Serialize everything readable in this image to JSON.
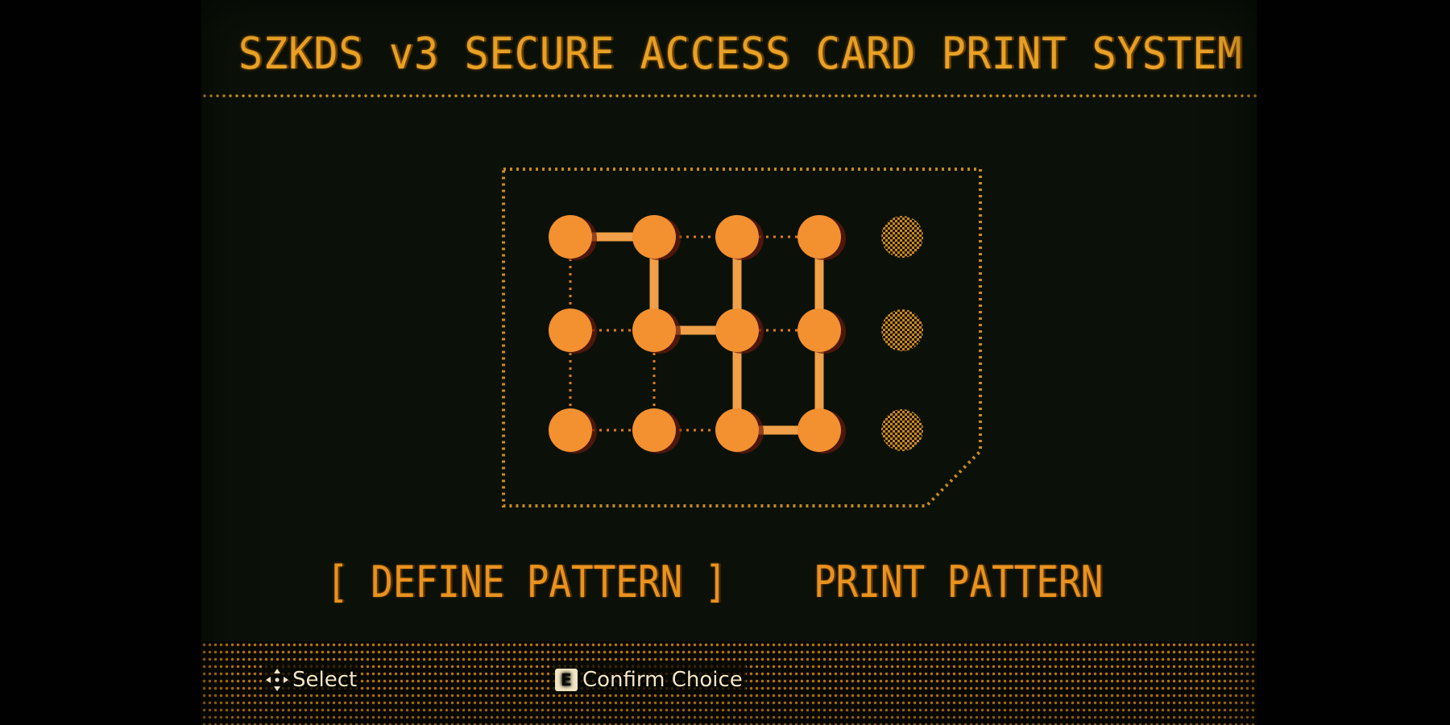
{
  "header": {
    "title": "SZKDS v3 SECURE ACCESS CARD PRINT SYSTEM"
  },
  "pattern": {
    "rows": 3,
    "cols": 4,
    "spare_column_count": 3,
    "path_segments": [
      [
        "r0c0",
        "r0c1"
      ],
      [
        "r0c1",
        "r1c1"
      ],
      [
        "r1c1",
        "r1c2"
      ],
      [
        "r0c2",
        "r1c2"
      ],
      [
        "r1c2",
        "r2c2"
      ],
      [
        "r2c2",
        "r2c3"
      ],
      [
        "r2c3",
        "r1c3"
      ],
      [
        "r1c3",
        "r0c3"
      ]
    ]
  },
  "menu": {
    "define_label": "[ DEFINE PATTERN ]",
    "print_label": "PRINT PATTERN",
    "selected": "define"
  },
  "footer": {
    "select_label": "Select",
    "confirm_label": "Confirm Choice",
    "confirm_key": "E"
  },
  "colors": {
    "accent": "#f08a24",
    "dot_fill": "#f39030",
    "line": "#f0a048",
    "frame": "#c98a1e",
    "background": "#0b1108"
  }
}
